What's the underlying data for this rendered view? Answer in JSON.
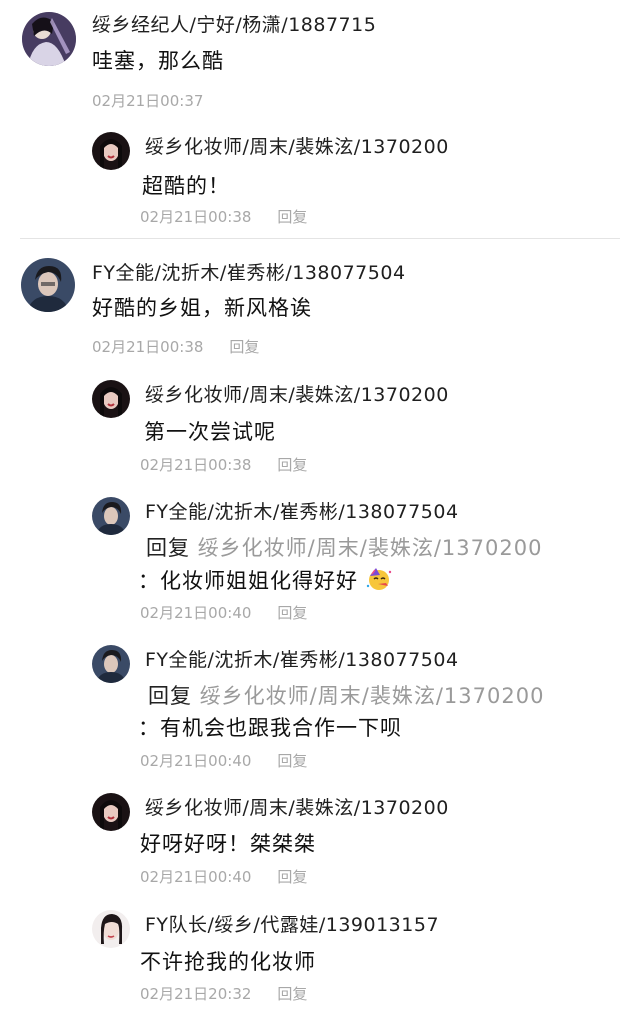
{
  "thread_1": {
    "comment": {
      "author": "绥乡经纪人/宁好/杨潇/1887715",
      "text": "哇塞，那么酷",
      "time": "02月21日00:37"
    },
    "replies": [
      {
        "author": "绥乡化妆师/周末/裴姝泫/1370200",
        "text": "超酷的！",
        "time": "02月21日00:38",
        "reply_label": "回复"
      }
    ]
  },
  "thread_2": {
    "comment": {
      "author": "FY全能/沈折木/崔秀彬/138077504",
      "text": "好酷的乡姐，新风格诶",
      "time": "02月21日00:38",
      "reply_label": "回复"
    },
    "replies": [
      {
        "author": "绥乡化妆师/周末/裴姝泫/1370200",
        "text": "第一次尝试呢",
        "time": "02月21日00:38",
        "reply_label": "回复"
      },
      {
        "author": "FY全能/沈折木/崔秀彬/138077504",
        "reply_prefix": "回复",
        "reply_target": "绥乡化妆师/周末/裴姝泫/1370200",
        "text": "：化妆师姐姐化得好好",
        "emoji": "partying-face-emoji",
        "time": "02月21日00:40",
        "reply_label": "回复"
      },
      {
        "author": "FY全能/沈折木/崔秀彬/138077504",
        "reply_prefix": "回复",
        "reply_target": "绥乡化妆师/周末/裴姝泫/1370200",
        "text": "：有机会也跟我合作一下呗",
        "time": "02月21日00:40",
        "reply_label": "回复"
      },
      {
        "author": "绥乡化妆师/周末/裴姝泫/1370200",
        "text": "好呀好呀！桀桀桀",
        "time": "02月21日00:40",
        "reply_label": "回复"
      },
      {
        "author": "FY队长/绥乡/代露娃/139013157",
        "text": "不许抢我的化妆师",
        "time": "02月21日20:32",
        "reply_label": "回复"
      }
    ]
  },
  "colors": {
    "text": "#111111",
    "meta": "#a8a8a8",
    "reply_target": "#9a9a9a",
    "divider": "#e4e4e4"
  }
}
